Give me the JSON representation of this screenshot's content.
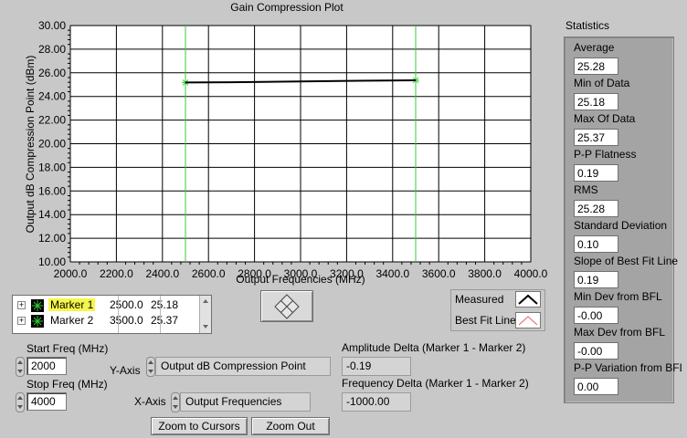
{
  "plot": {
    "title": "Gain Compression Plot",
    "xlabel": "Output Frequencies (MHz)",
    "ylabel": "Output dB Compression Point (dBm)",
    "x_ticks": [
      "2000.0",
      "2200.0",
      "2400.0",
      "2600.0",
      "2800.0",
      "3000.0",
      "3200.0",
      "3400.0",
      "3600.0",
      "3800.0",
      "4000.0"
    ],
    "y_ticks": [
      "10.00",
      "12.00",
      "14.00",
      "16.00",
      "18.00",
      "20.00",
      "22.00",
      "24.00",
      "26.00",
      "28.00",
      "30.00"
    ]
  },
  "chart_data": {
    "type": "line",
    "title": "Gain Compression Plot",
    "xlabel": "Output Frequencies (MHz)",
    "ylabel": "Output dB Compression Point (dBm)",
    "xlim": [
      2000,
      4000
    ],
    "ylim": [
      10,
      30
    ],
    "grid": true,
    "series": [
      {
        "name": "Measured",
        "color": "#000000",
        "x": [
          2500,
          2750,
          3000,
          3250,
          3500
        ],
        "y": [
          25.18,
          25.21,
          25.27,
          25.33,
          25.37
        ]
      }
    ],
    "cursors": [
      {
        "name": "Marker 1",
        "x": 2500,
        "y": 25.18,
        "color": "#33cc33"
      },
      {
        "name": "Marker 2",
        "x": 3500,
        "y": 25.37,
        "color": "#33cc33"
      }
    ]
  },
  "markers": [
    {
      "name": "Marker 1",
      "x": "2500.0",
      "y": "25.18"
    },
    {
      "name": "Marker 2",
      "x": "3500.0",
      "y": "25.37"
    }
  ],
  "legend": {
    "measured": "Measured",
    "best_fit": "Best Fit Line",
    "colors": {
      "measured": "#000000",
      "best_fit": "#e06060"
    }
  },
  "controls": {
    "start_freq_label": "Start Freq (MHz)",
    "start_freq_value": "2000",
    "stop_freq_label": "Stop Freq (MHz)",
    "stop_freq_value": "4000",
    "y_axis_label": "Y-Axis",
    "y_axis_value": "Output dB Compression Point",
    "x_axis_label": "X-Axis",
    "x_axis_value": "Output Frequencies",
    "amp_delta_label": "Amplitude Delta (Marker 1 - Marker 2)",
    "amp_delta_value": "-0.19",
    "freq_delta_label": "Frequency Delta (Marker 1 - Marker 2)",
    "freq_delta_value": "-1000.00",
    "zoom_cursors_label": "Zoom to Cursors",
    "zoom_out_label": "Zoom Out"
  },
  "statistics": {
    "title": "Statistics",
    "items": [
      {
        "label": "Average",
        "value": "25.28"
      },
      {
        "label": "Min of Data",
        "value": "25.18"
      },
      {
        "label": "Max Of Data",
        "value": "25.37"
      },
      {
        "label": "P-P Flatness",
        "value": "0.19"
      },
      {
        "label": "RMS",
        "value": "25.28"
      },
      {
        "label": "Standard Deviation",
        "value": "0.10"
      },
      {
        "label": "Slope of Best Fit Line",
        "value": "0.19"
      },
      {
        "label": "Min Dev from BFL",
        "value": "-0.00"
      },
      {
        "label": "Max Dev from BFL",
        "value": "-0.00"
      },
      {
        "label": "P-P Variation from BFL",
        "value": "0.00"
      }
    ]
  }
}
